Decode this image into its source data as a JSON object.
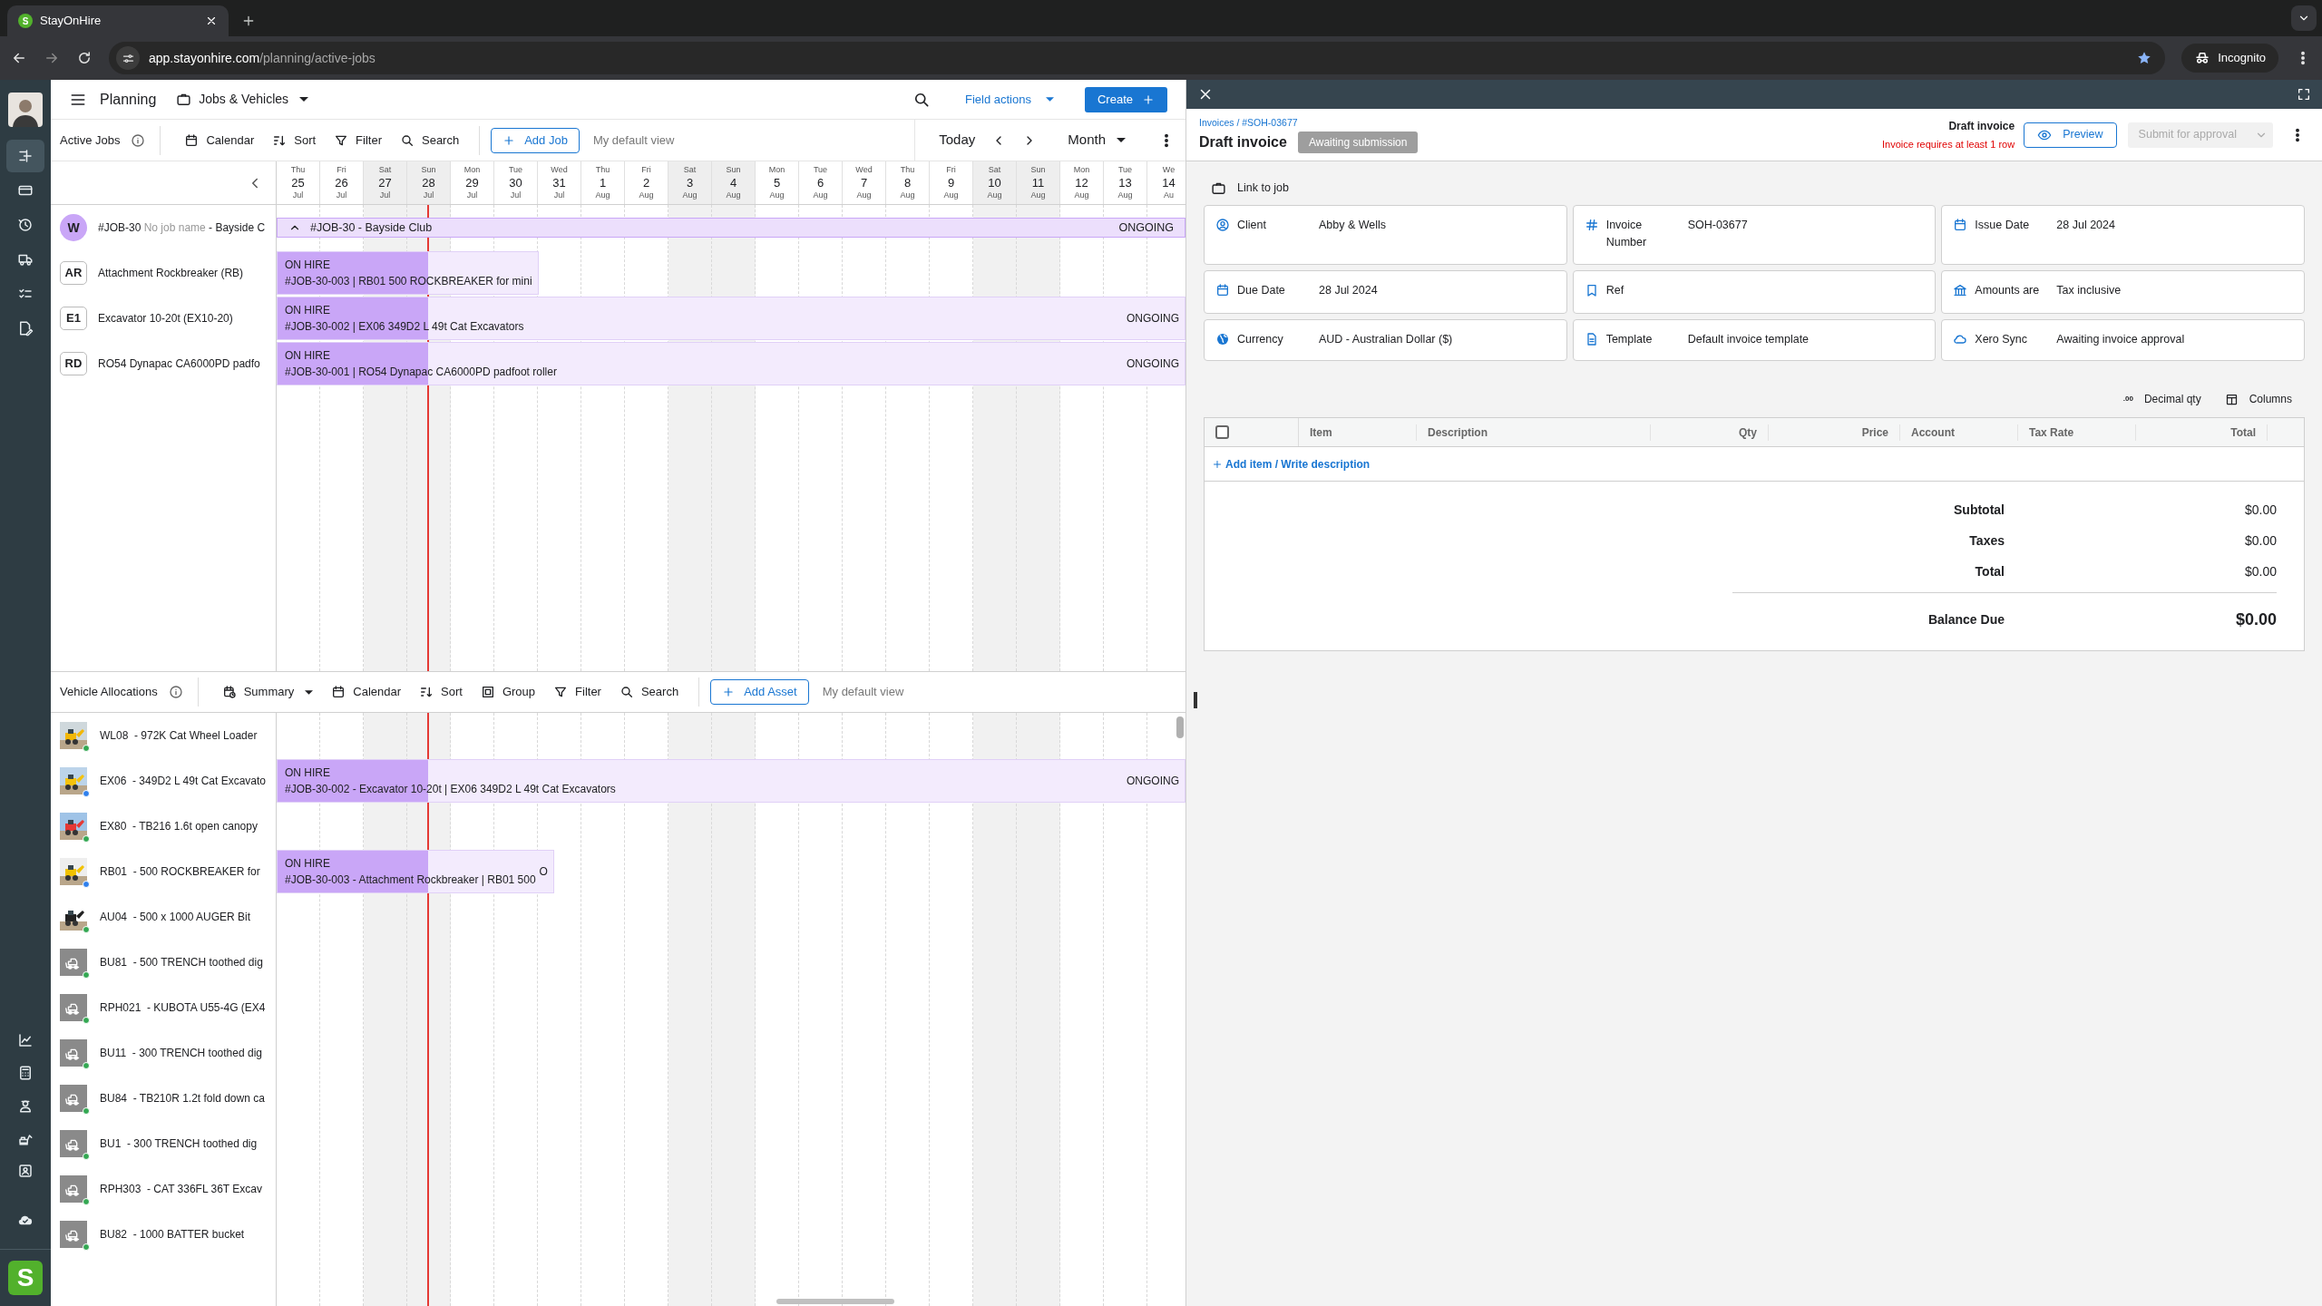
{
  "browser": {
    "tab_title": "StayOnHire",
    "favicon": "S",
    "url_host": "app.stayonhire.com",
    "url_path": "/planning/active-jobs",
    "profile": "Incognito"
  },
  "rail": {
    "logo": "S",
    "items_top": [
      {
        "selected": true
      },
      {
        "selected": false
      },
      {
        "selected": false
      },
      {
        "selected": false
      },
      {
        "selected": false
      },
      {
        "selected": false
      }
    ],
    "items_bottom": [
      {
        "selected": false
      },
      {
        "selected": false
      },
      {
        "selected": false
      },
      {
        "selected": false
      },
      {
        "selected": false
      },
      {
        "selected": false
      }
    ]
  },
  "header": {
    "title": "Planning",
    "view": "Jobs & Vehicles",
    "field_actions": "Field actions",
    "create": "Create"
  },
  "jobs_toolbar": {
    "title": "Active Jobs",
    "tools": [
      "Calendar",
      "Sort",
      "Filter",
      "Search"
    ],
    "add": "Add Job",
    "view": "My default view",
    "today": "Today",
    "period": "Month"
  },
  "days": [
    {
      "dow": "Thu",
      "day": "25",
      "month": "Jul",
      "weekend": false
    },
    {
      "dow": "Fri",
      "day": "26",
      "month": "Jul",
      "weekend": false
    },
    {
      "dow": "Sat",
      "day": "27",
      "month": "Jul",
      "weekend": true
    },
    {
      "dow": "Sun",
      "day": "28",
      "month": "Jul",
      "weekend": true
    },
    {
      "dow": "Mon",
      "day": "29",
      "month": "Jul",
      "weekend": false
    },
    {
      "dow": "Tue",
      "day": "30",
      "month": "Jul",
      "weekend": false
    },
    {
      "dow": "Wed",
      "day": "31",
      "month": "Jul",
      "weekend": false
    },
    {
      "dow": "Thu",
      "day": "1",
      "month": "Aug",
      "weekend": false
    },
    {
      "dow": "Fri",
      "day": "2",
      "month": "Aug",
      "weekend": false
    },
    {
      "dow": "Sat",
      "day": "3",
      "month": "Aug",
      "weekend": true
    },
    {
      "dow": "Sun",
      "day": "4",
      "month": "Aug",
      "weekend": true
    },
    {
      "dow": "Mon",
      "day": "5",
      "month": "Aug",
      "weekend": false
    },
    {
      "dow": "Tue",
      "day": "6",
      "month": "Aug",
      "weekend": false
    },
    {
      "dow": "Wed",
      "day": "7",
      "month": "Aug",
      "weekend": false
    },
    {
      "dow": "Thu",
      "day": "8",
      "month": "Aug",
      "weekend": false
    },
    {
      "dow": "Fri",
      "day": "9",
      "month": "Aug",
      "weekend": false
    },
    {
      "dow": "Sat",
      "day": "10",
      "month": "Aug",
      "weekend": true
    },
    {
      "dow": "Sun",
      "day": "11",
      "month": "Aug",
      "weekend": true
    },
    {
      "dow": "Mon",
      "day": "12",
      "month": "Aug",
      "weekend": false
    },
    {
      "dow": "Tue",
      "day": "13",
      "month": "Aug",
      "weekend": false
    },
    {
      "dow": "We",
      "day": "14",
      "month": "Au",
      "weekend": false
    }
  ],
  "job": {
    "badge": "W",
    "number": "#JOB-30",
    "note": "No job name",
    "suffix": "- Bayside C",
    "bar": "#JOB-30 - Bayside Club",
    "end_label": "ONGOING",
    "expanded": true
  },
  "allocations": [
    {
      "badge": "AR",
      "name": "Attachment Rockbreaker (RB)",
      "status": "ON HIRE",
      "text": "#JOB-30-003 | RB01 500 ROCKBREAKER for mini",
      "ongoing": false
    },
    {
      "badge": "E1",
      "name": "Excavator 10-20t (EX10-20)",
      "status": "ON HIRE",
      "text": "#JOB-30-002 | EX06 349D2 L 49t Cat Excavators",
      "ongoing": true,
      "end_label": "ONGOING"
    },
    {
      "badge": "RD",
      "name": "RO54 Dynapac CA6000PD padfo",
      "status": "ON HIRE",
      "text": "#JOB-30-001 | RO54 Dynapac CA6000PD padfoot roller",
      "ongoing": true,
      "end_label": "ONGOING"
    }
  ],
  "vehicles_toolbar": {
    "title": "Vehicle Allocations",
    "summary": "Summary",
    "tools": [
      "Calendar",
      "Sort",
      "Group",
      "Filter",
      "Search"
    ],
    "add": "Add Asset",
    "view": "My default view"
  },
  "vehicles": [
    {
      "label": "WL08  - 972K Cat Wheel Loader",
      "color": "#34a853"
    },
    {
      "label": "EX06  - 349D2 L 49t Cat Excavato",
      "color": "#2f80ed",
      "booking": {
        "status": "ON HIRE",
        "text": "#JOB-30-002 - Excavator 10-20t | EX06 349D2 L 49t Cat Excavators",
        "ongoing": true,
        "end_label": "ONGOING"
      }
    },
    {
      "label": "EX80  - TB216 1.6t open canopy",
      "color": "#34a853"
    },
    {
      "label": "RB01  - 500 ROCKBREAKER for",
      "color": "#2f80ed",
      "booking": {
        "status": "ON HIRE",
        "text": "#JOB-30-003 - Attachment Rockbreaker | RB01 500",
        "ongoing": false,
        "end_label": "O"
      }
    },
    {
      "label": "AU04  - 500 x 1000 AUGER Bit",
      "color": "#34a853"
    },
    {
      "label": "BU81  - 500 TRENCH toothed dig",
      "kind": "placeholder",
      "color": "#34a853"
    },
    {
      "label": "RPH021  - KUBOTA U55-4G (EX4",
      "kind": "placeholder",
      "color": "#34a853"
    },
    {
      "label": "BU11  - 300 TRENCH toothed dig",
      "kind": "placeholder",
      "color": "#34a853"
    },
    {
      "label": "BU84  - TB210R 1.2t fold down ca",
      "kind": "placeholder",
      "color": "#34a853"
    },
    {
      "label": "BU1  - 300 TRENCH toothed dig",
      "kind": "placeholder",
      "color": "#34a853"
    },
    {
      "label": "RPH303  - CAT 336FL 36T Excav",
      "kind": "placeholder",
      "color": "#34a853"
    },
    {
      "label": "BU82  - 1000 BATTER bucket",
      "kind": "placeholder",
      "color": "#34a853"
    }
  ],
  "invoice": {
    "breadcrumb": "Invoices / #SOH-03677",
    "title": "Draft invoice",
    "badge": "Awaiting submission",
    "status_title": "Draft invoice",
    "warning": "Invoice requires at least 1 row",
    "preview": "Preview",
    "submit": "Submit for approval",
    "submit_disabled": true,
    "link_to_job": "Link to job",
    "fields": [
      {
        "label": "Client",
        "value": "Abby & Wells"
      },
      {
        "label": "Invoice Number",
        "value": "SOH-03677"
      },
      {
        "label": "Issue Date",
        "value": "28 Jul 2024"
      },
      {
        "label": "Due Date",
        "value": "28 Jul 2024"
      },
      {
        "label": "Ref"
      },
      {
        "label": "Amounts are",
        "value": "Tax inclusive"
      },
      {
        "label": "Currency",
        "value": "AUD - Australian Dollar ($)"
      },
      {
        "label": "Template",
        "value": "Default invoice template"
      },
      {
        "label": "Xero Sync",
        "value": "Awaiting invoice approval"
      }
    ],
    "decimal_icon": ".00",
    "decimal": "Decimal qty",
    "columns_button": "Columns",
    "select_all": false,
    "columns": [
      "Item",
      "Description",
      "Qty",
      "Price",
      "Account",
      "Tax Rate",
      "Total"
    ],
    "add_item": "Add item / Write description",
    "totals": [
      {
        "label": "Subtotal",
        "value": "$0.00",
        "kind": "line"
      },
      {
        "label": "Taxes",
        "value": "$0.00",
        "kind": "line"
      },
      {
        "label": "Total",
        "value": "$0.00",
        "kind": "line"
      },
      {
        "label": "Balance Due",
        "value": "$0.00",
        "kind": "balance"
      }
    ]
  }
}
